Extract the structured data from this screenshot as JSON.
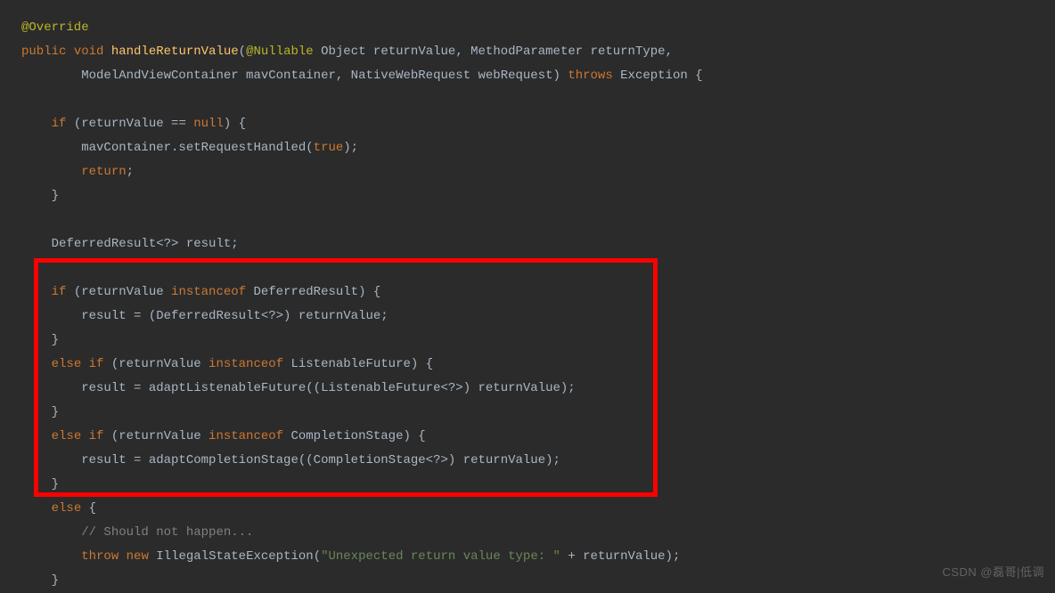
{
  "code": {
    "l1_annotation": "@Override",
    "l2_pub": "public",
    "l2_void": "void",
    "l2_method": "handleReturnValue",
    "l2_paren_open": "(",
    "l2_nullable": "@Nullable",
    "l2_sig1": " Object returnValue, MethodParameter returnType,",
    "l3_sig2": "ModelAndViewContainer mavContainer, NativeWebRequest webRequest) ",
    "l3_throws": "throws",
    "l3_exc": " Exception {",
    "l5_if": "if",
    "l5_cond": " (returnValue == ",
    "l5_null": "null",
    "l5_brace": ") {",
    "l6_stmt1": "mavContainer.setRequestHandled(",
    "l6_true": "true",
    "l6_end": ");",
    "l7_return": "return",
    "l7_semi": ";",
    "l8_close": "}",
    "l10_decl": "DeferredResult<?> result;",
    "l12_if": "if",
    "l12_p1": " (returnValue ",
    "l12_instof": "instanceof",
    "l12_p2": " DeferredResult) {",
    "l13_assign": "result = (DeferredResult<?>) returnValue;",
    "l14_close": "}",
    "l15_else": "else if",
    "l15_p1": " (returnValue ",
    "l15_instof": "instanceof",
    "l15_p2": " ListenableFuture) {",
    "l16_assign": "result = adaptListenableFuture((ListenableFuture<?>) returnValue);",
    "l17_close": "}",
    "l18_else": "else if",
    "l18_p1": " (returnValue ",
    "l18_instof": "instanceof",
    "l18_p2": " CompletionStage) {",
    "l19_assign": "result = adaptCompletionStage((CompletionStage<?>) returnValue);",
    "l20_close": "}",
    "l21_else": "else",
    "l21_brace": " {",
    "l22_comment": "// Should not happen...",
    "l23_throw": "throw",
    "l23_new": "new",
    "l23_ex": " IllegalStateException(",
    "l23_str": "\"Unexpected return value type: \"",
    "l23_plus": " + returnValue);",
    "l24_close": "}"
  },
  "watermark": "CSDN @磊哥|低调"
}
